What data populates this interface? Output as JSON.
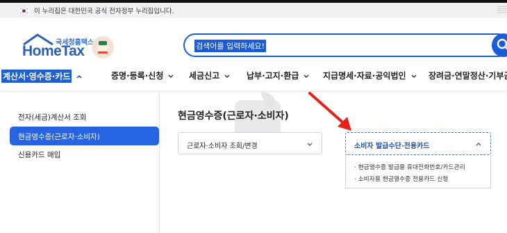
{
  "gov_banner": {
    "text": "이 누리집은 대한민국 공식 전자정부 누리집입니다."
  },
  "logo": {
    "sub": "국세청홈택스",
    "main": "HomeTax"
  },
  "search": {
    "placeholder": "검색어를 입력하세요!"
  },
  "nav": {
    "items": [
      {
        "label": "계산서·영수증·카드"
      },
      {
        "label": "증명·등록·신청"
      },
      {
        "label": "세금신고"
      },
      {
        "label": "납부·고지·환급"
      },
      {
        "label": "지급명세·자료·공익법인"
      },
      {
        "label": "장려금·연말정산·기부금"
      }
    ]
  },
  "sidebar": {
    "items": [
      {
        "label": "전자(세금)계산서 조회"
      },
      {
        "label": "현금영수증(근로자·소비자)"
      },
      {
        "label": "신용카드 매입"
      }
    ]
  },
  "main": {
    "title": "현금영수증(근로자·소비자)",
    "select1": "근로자·소비자 조회/변경",
    "select2": "소비자 발급수단·전용카드",
    "dropdown": [
      "· 현금영수증 발급용 휴대전화번호/카드관리",
      "· 소비자용 현금영수증 전용카드 신청"
    ]
  },
  "colors": {
    "accent": "#1f5fd1",
    "annotation": "#e8201a"
  },
  "icons": [
    "korea-flag-icon",
    "search-icon",
    "chevron-down-icon",
    "chevron-up-icon",
    "annotation-arrow-icon"
  ]
}
